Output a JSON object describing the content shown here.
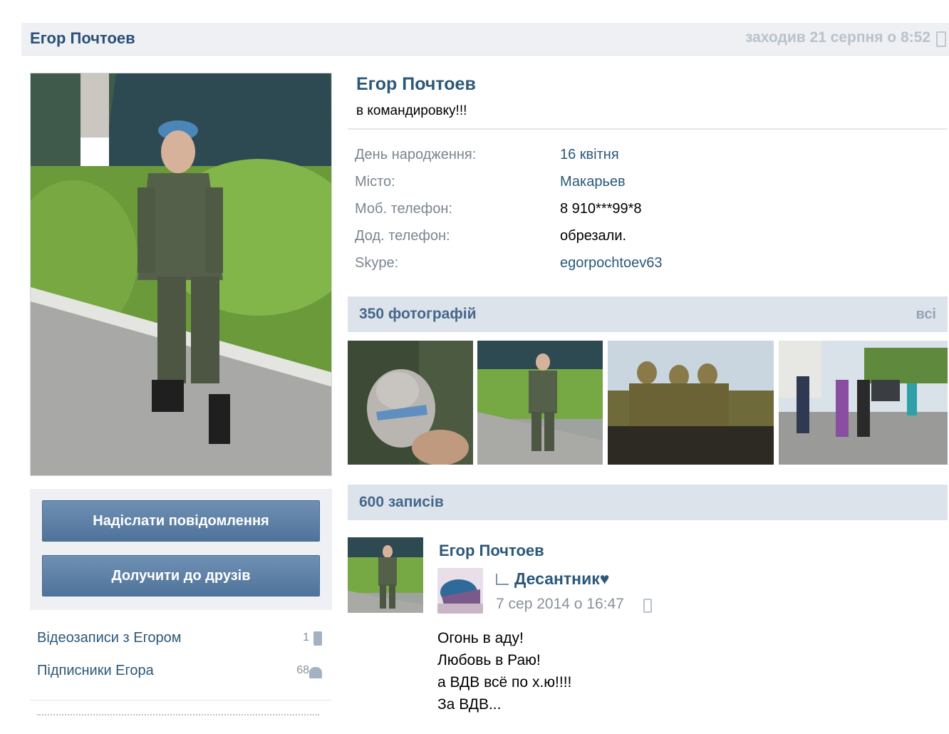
{
  "header": {
    "name": "Егор Почтоев",
    "last_seen": "заходив 21 серпня о 8:52"
  },
  "actions": {
    "send_message": "Надіслати повідомлення",
    "add_friend": "Долучити до друзів"
  },
  "side_links": [
    {
      "label": "Відеозаписи з Егором",
      "count": "1"
    },
    {
      "label": "Підписники Егора",
      "count": "68"
    }
  ],
  "profile": {
    "name": "Егор Почтоев",
    "status": "в командировку!!!",
    "info": [
      {
        "key": "День народження:",
        "value": "16 квітня"
      },
      {
        "key": "Місто:",
        "value": "Макарьев"
      },
      {
        "key": "Моб. телефон:",
        "value": "8 910***99*8"
      },
      {
        "key": "Дод. телефон:",
        "value": "обрезали."
      },
      {
        "key": "Skype:",
        "value": "egorpochtoev63"
      }
    ]
  },
  "photos": {
    "title": "350 фотографій",
    "all_label": "всі"
  },
  "posts": {
    "title": "600 записів",
    "items": [
      {
        "author": "Егор Почтоев",
        "repost_from": "Десантник♥",
        "time": "7 сер 2014 о 16:47",
        "lines": [
          "Огонь в аду!",
          "Любовь в Раю!",
          "а ВДВ всё по х.ю!!!!",
          "За ВДВ..."
        ]
      }
    ]
  },
  "colors": {
    "link": "#2b587a",
    "button": "#5b7fa6",
    "section_bar": "#dde3ea"
  }
}
